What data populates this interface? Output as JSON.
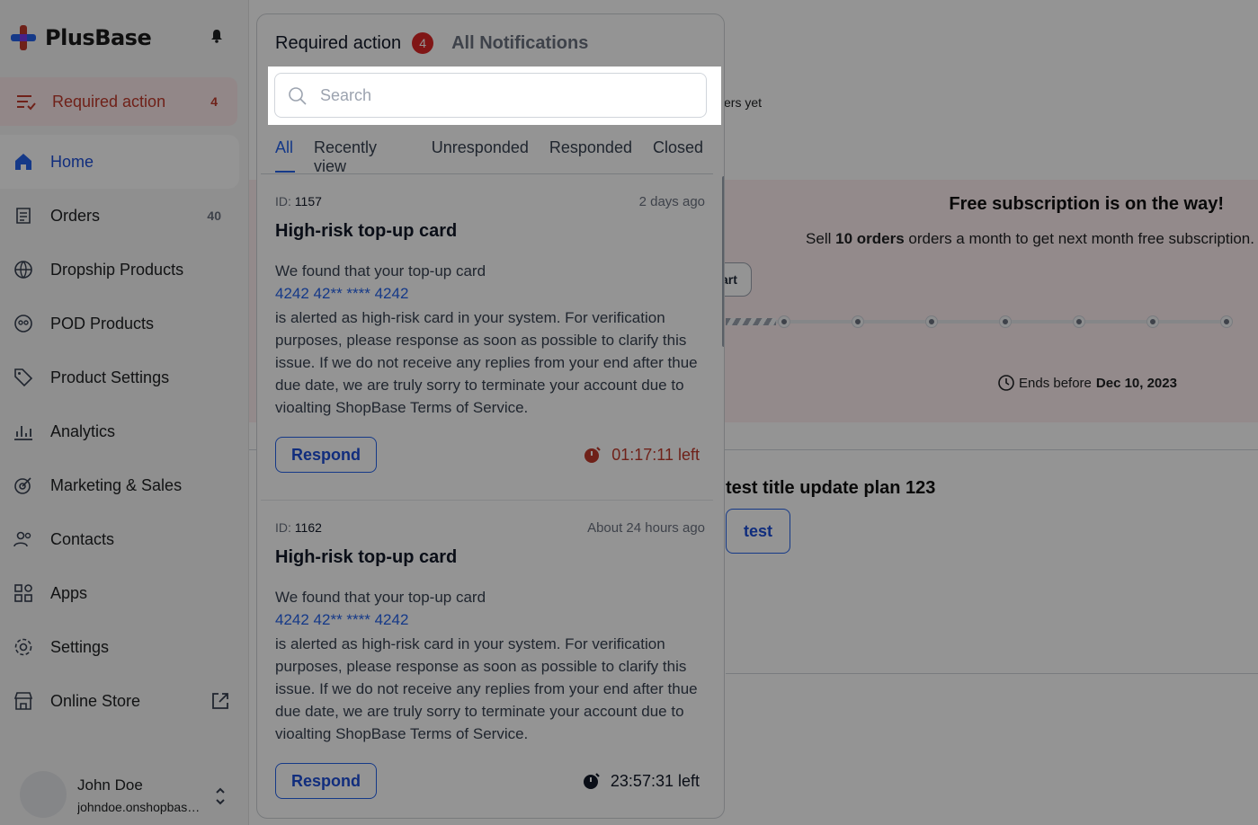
{
  "app": {
    "brand": "PlusBase"
  },
  "sidebar": {
    "required_action": {
      "label": "Required action",
      "count": "4"
    },
    "items": [
      {
        "label": "Home",
        "icon": "home-icon",
        "active": true
      },
      {
        "label": "Orders",
        "icon": "orders-icon",
        "count": "40"
      },
      {
        "label": "Dropship Products",
        "icon": "dropship-icon"
      },
      {
        "label": "POD Products",
        "icon": "pod-icon"
      },
      {
        "label": "Product Settings",
        "icon": "tag-icon"
      },
      {
        "label": "Analytics",
        "icon": "analytics-icon"
      },
      {
        "label": "Marketing & Sales",
        "icon": "target-icon"
      },
      {
        "label": "Contacts",
        "icon": "contacts-icon"
      },
      {
        "label": "Apps",
        "icon": "apps-icon"
      },
      {
        "label": "Settings",
        "icon": "gear-icon"
      },
      {
        "label": "Online Store",
        "icon": "store-icon"
      }
    ],
    "user": {
      "name": "John Doe",
      "email": "johndoe.onshopbase.com"
    }
  },
  "background": {
    "orders_yet": "ers yet",
    "promo": {
      "title": "Free subscription is on the way!",
      "sub_prefix": "Sell ",
      "sub_bold": "10 orders",
      "sub_suffix": " orders a month to get next month free subscription.",
      "start_label": "art",
      "ends_prefix": "Ends before",
      "ends_date": "Dec 10, 2023"
    },
    "plan_title": "test title update plan 123",
    "plan_button": "test"
  },
  "panel": {
    "title": "Required action",
    "badge": "4",
    "all_notifications": "All Notifications",
    "search": {
      "placeholder": "Search",
      "value": ""
    },
    "tabs": [
      "All",
      "Recently view",
      "Unresponded",
      "Responded",
      "Closed"
    ],
    "cards": [
      {
        "id_label": "ID:",
        "id": "1157",
        "time": "2 days ago",
        "title": "High-risk top-up card",
        "intro": "We found that your top-up card",
        "card_number": "4242 42** **** 4242",
        "body": "is alerted as high-risk card in your system. For verification purposes, please response as soon as possible to clarify this issue. If we do not receive any replies from your end after thue due date, we are truly sorry to terminate your account due to vioalting ShopBase Terms of Service.",
        "button": "Respond",
        "timer": "01:17:11 left",
        "timer_color": "#c0392b"
      },
      {
        "id_label": "ID:",
        "id": "1162",
        "time": "About 24 hours ago",
        "title": "High-risk top-up card",
        "intro": "We found that your top-up card",
        "card_number": "4242 42** **** 4242",
        "body": "is alerted as high-risk card in your system. For verification purposes, please response as soon as possible to clarify this issue. If we do not receive any replies from your end after thue due date, we are truly sorry to terminate your account due to vioalting ShopBase Terms of Service.",
        "button": "Respond",
        "timer": "23:57:31 left",
        "timer_color": "#111827"
      }
    ]
  }
}
